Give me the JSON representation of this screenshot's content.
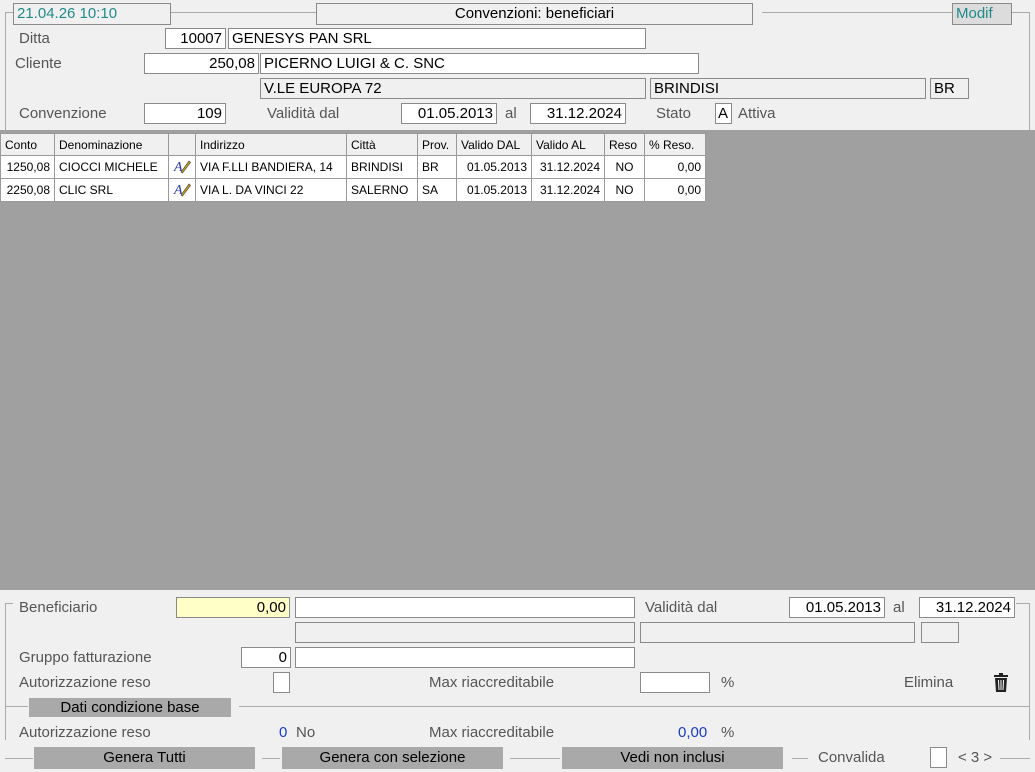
{
  "header": {
    "timestamp": "21.04.26 10:10",
    "title": "Convenzioni: beneficiari",
    "mode": "Modif"
  },
  "ditta": {
    "label": "Ditta",
    "code": "10007",
    "name": "GENESYS PAN SRL"
  },
  "cliente": {
    "label": "Cliente",
    "code": "250,08",
    "name": "PICERNO LUIGI & C. SNC",
    "address": "V.LE EUROPA 72",
    "city": "BRINDISI",
    "province": "BR"
  },
  "convenzione": {
    "label": "Convenzione",
    "number": "109",
    "validity_label": "Validità dal",
    "from": "01.05.2013",
    "to_label": "al",
    "to": "31.12.2024",
    "status_label": "Stato",
    "status_code": "A",
    "status_text": "Attiva"
  },
  "table": {
    "columns": [
      "Conto",
      "Denominazione",
      "",
      "Indirizzo",
      "Città",
      "Prov.",
      "Valido DAL",
      "Valido AL",
      "Reso",
      "% Reso."
    ],
    "rows": [
      {
        "conto": "1250,08",
        "denominazione": "CIOCCI MICHELE",
        "icon": "edit-text-icon",
        "indirizzo": "VIA F.LLI BANDIERA, 14",
        "citta": "BRINDISI",
        "prov": "BR",
        "dal": "01.05.2013",
        "al": "31.12.2024",
        "reso": "NO",
        "perc": "0,00"
      },
      {
        "conto": "2250,08",
        "denominazione": "CLIC SRL",
        "icon": "edit-text-icon",
        "indirizzo": "VIA L. DA VINCI 22",
        "citta": "SALERNO",
        "prov": "SA",
        "dal": "01.05.2013",
        "al": "31.12.2024",
        "reso": "NO",
        "perc": "0,00"
      }
    ]
  },
  "detail": {
    "beneficiario_label": "Beneficiario",
    "beneficiario_code": "0,00",
    "beneficiario_name": "",
    "validita_label": "Validità  dal",
    "validita_from": "01.05.2013",
    "validita_to_label": "al",
    "validita_to": "31.12.2024",
    "gruppo_label": "Gruppo fatturazione",
    "gruppo_code": "0",
    "gruppo_name": "",
    "autorizzazione_label": "Autorizzazione reso",
    "max_label": "Max riaccreditabile",
    "percent_sign": "%",
    "elimina_label": "Elimina"
  },
  "base": {
    "section_label": "Dati condizione base",
    "autorizzazione_label": "Autorizzazione reso",
    "autorizzazione_value": "0",
    "autorizzazione_text": "No",
    "max_label": "Max riaccreditabile",
    "max_value": "0,00",
    "percent_sign": "%"
  },
  "footer": {
    "genera_tutti": "Genera Tutti",
    "genera_selezione": "Genera con selezione",
    "vedi_non_inclusi": "Vedi non inclusi",
    "convalida_label": "Convalida",
    "pager": "< 3 >"
  }
}
